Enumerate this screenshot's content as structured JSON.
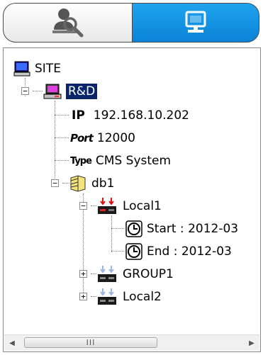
{
  "tabs": [
    {
      "icon": "search-user-icon",
      "active": false
    },
    {
      "icon": "monitor-icon",
      "active": true
    }
  ],
  "colors": {
    "accent": "#1090e0",
    "selection": "#0a246a"
  },
  "tree": {
    "site": "SITE",
    "server": "R&D",
    "ip_label": "IP",
    "ip_value": "192.168.10.202",
    "port_label": "Port",
    "port_value": "12000",
    "type_label": "Type",
    "type_value": "CMS System",
    "db": "db1",
    "local1": "Local1",
    "start": "Start : 2012-03",
    "end": "End : 2012-03",
    "group1": "GROUP1",
    "local2": "Local2"
  },
  "scrollbar": {
    "grip": "III"
  }
}
